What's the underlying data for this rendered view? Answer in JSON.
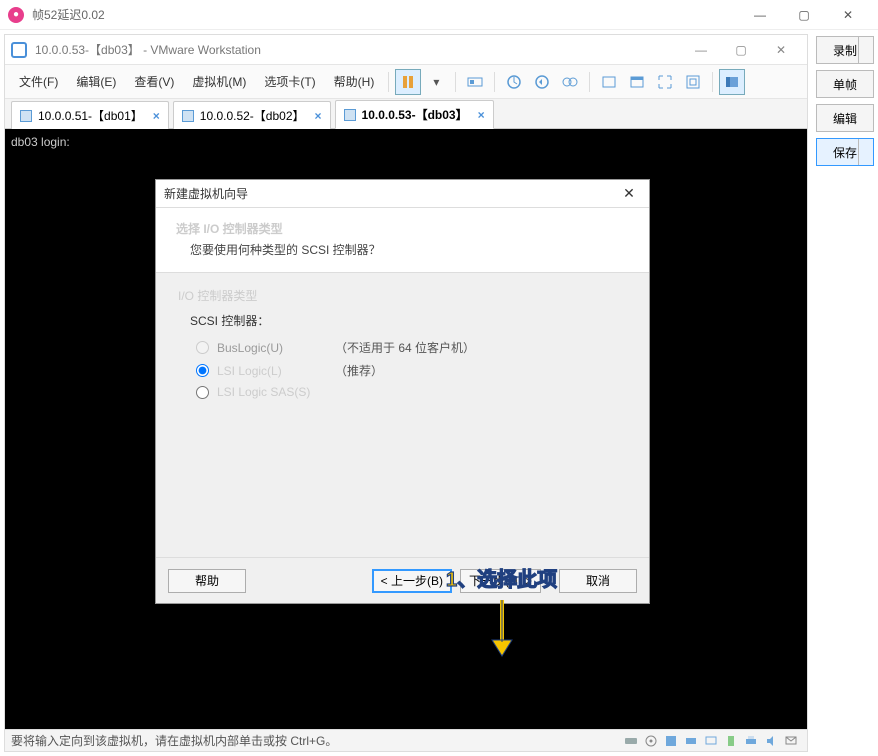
{
  "outer": {
    "title": "帧52延迟0.02",
    "win": {
      "min": "—",
      "max": "▢",
      "close": "✕"
    }
  },
  "side": {
    "record": "录制",
    "frame": "单帧",
    "edit": "编辑",
    "save": "保存"
  },
  "vmware": {
    "title": "10.0.0.53-【db03】 - VMware Workstation",
    "menu": {
      "file": "文件(F)",
      "edit": "编辑(E)",
      "view": "查看(V)",
      "vm": "虚拟机(M)",
      "tabs": "选项卡(T)",
      "help": "帮助(H)"
    },
    "tabs": [
      {
        "label": "10.0.0.51-【db01】",
        "active": false
      },
      {
        "label": "10.0.0.52-【db02】",
        "active": false
      },
      {
        "label": "10.0.0.53-【db03】",
        "active": true
      }
    ],
    "console": "db03 login:",
    "status": "要将输入定向到该虚拟机，请在虚拟机内部单击或按 Ctrl+G。"
  },
  "wizard": {
    "title": "新建虚拟机向导",
    "h1": "选择 I/O 控制器类型",
    "h2": "您要使用何种类型的 SCSI 控制器？",
    "group": "I/O 控制器类型",
    "sub": "SCSI 控制器：",
    "opts": {
      "buslogic": {
        "label": "BusLogic(U)",
        "note": "（不适用于 64 位客户机）"
      },
      "lsi": {
        "label": "LSI Logic(L)",
        "note": "（推荐）"
      },
      "lsisas": {
        "label": "LSI Logic SAS(S)",
        "note": ""
      }
    },
    "annotation": "1、选择此项",
    "buttons": {
      "help": "帮助",
      "back": "< 上一步(B)",
      "next": "下一步(N) >",
      "cancel": "取消"
    }
  }
}
